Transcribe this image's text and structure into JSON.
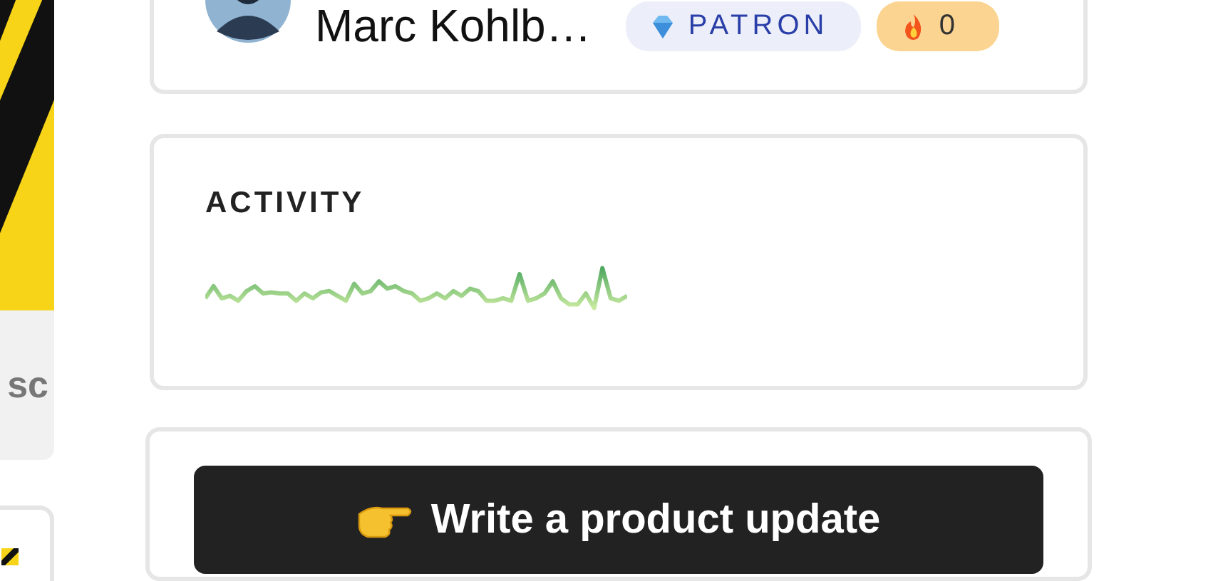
{
  "profile": {
    "name": "Marc Kohlb…",
    "badges": [
      {
        "kind": "patron",
        "label": "PATRON"
      },
      {
        "kind": "streak",
        "label": "0"
      }
    ]
  },
  "sidebar": {
    "card_text": "sc"
  },
  "activity": {
    "title": "ACTIVITY"
  },
  "action": {
    "label": "Write a product update"
  }
}
